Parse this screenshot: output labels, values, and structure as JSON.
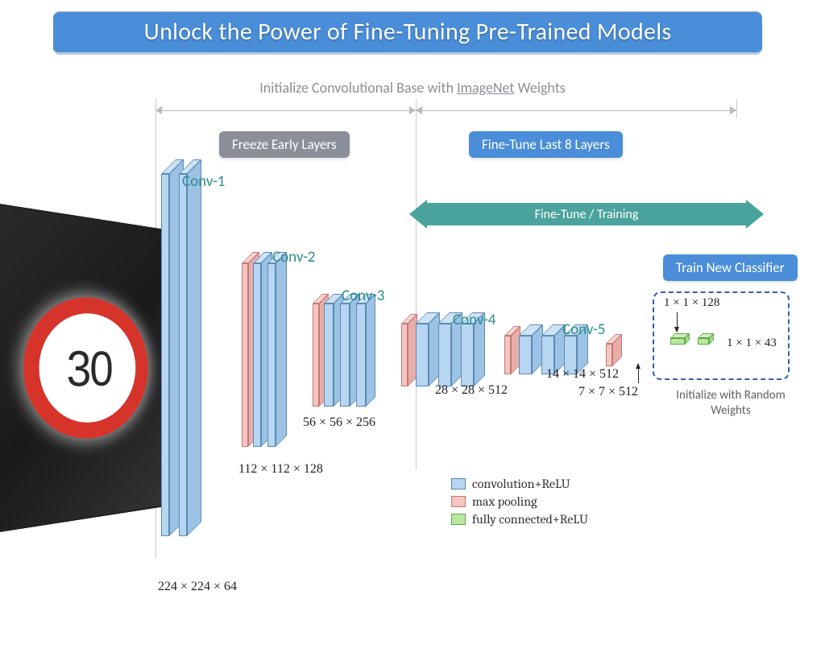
{
  "title": "Unlock the Power of Fine-Tuning Pre-Trained Models",
  "subtitle_pre": "Initialize Convolutional Base with ",
  "subtitle_ul": "ImageNet",
  "subtitle_post": " Weights",
  "pills": {
    "freeze": "Freeze Early Layers",
    "finetune": "Fine-Tune Last 8 Layers",
    "train_classifier": "Train New Classifier"
  },
  "ft_bar": "Fine-Tune / Training",
  "conv_labels": {
    "c1": "Conv-1",
    "c2": "Conv-2",
    "c3": "Conv-3",
    "c4": "Conv-4",
    "c5": "Conv-5"
  },
  "dims": {
    "c1": "224 × 224 × 64",
    "c2": "112 × 112 × 128",
    "c3": "56 × 56 × 256",
    "c4": "28 × 28 × 512",
    "c5a": "14 × 14 × 512",
    "c5pool": "7 × 7 × 512",
    "fc1": "1 × 1 × 128",
    "fc2": "1 × 1 × 43"
  },
  "classifier_note": "Initialize with Random Weights",
  "legend": {
    "conv": "convolution+ReLU",
    "pool": "max pooling",
    "fc": "fully connected+ReLU"
  },
  "input_sign_text": "30"
}
